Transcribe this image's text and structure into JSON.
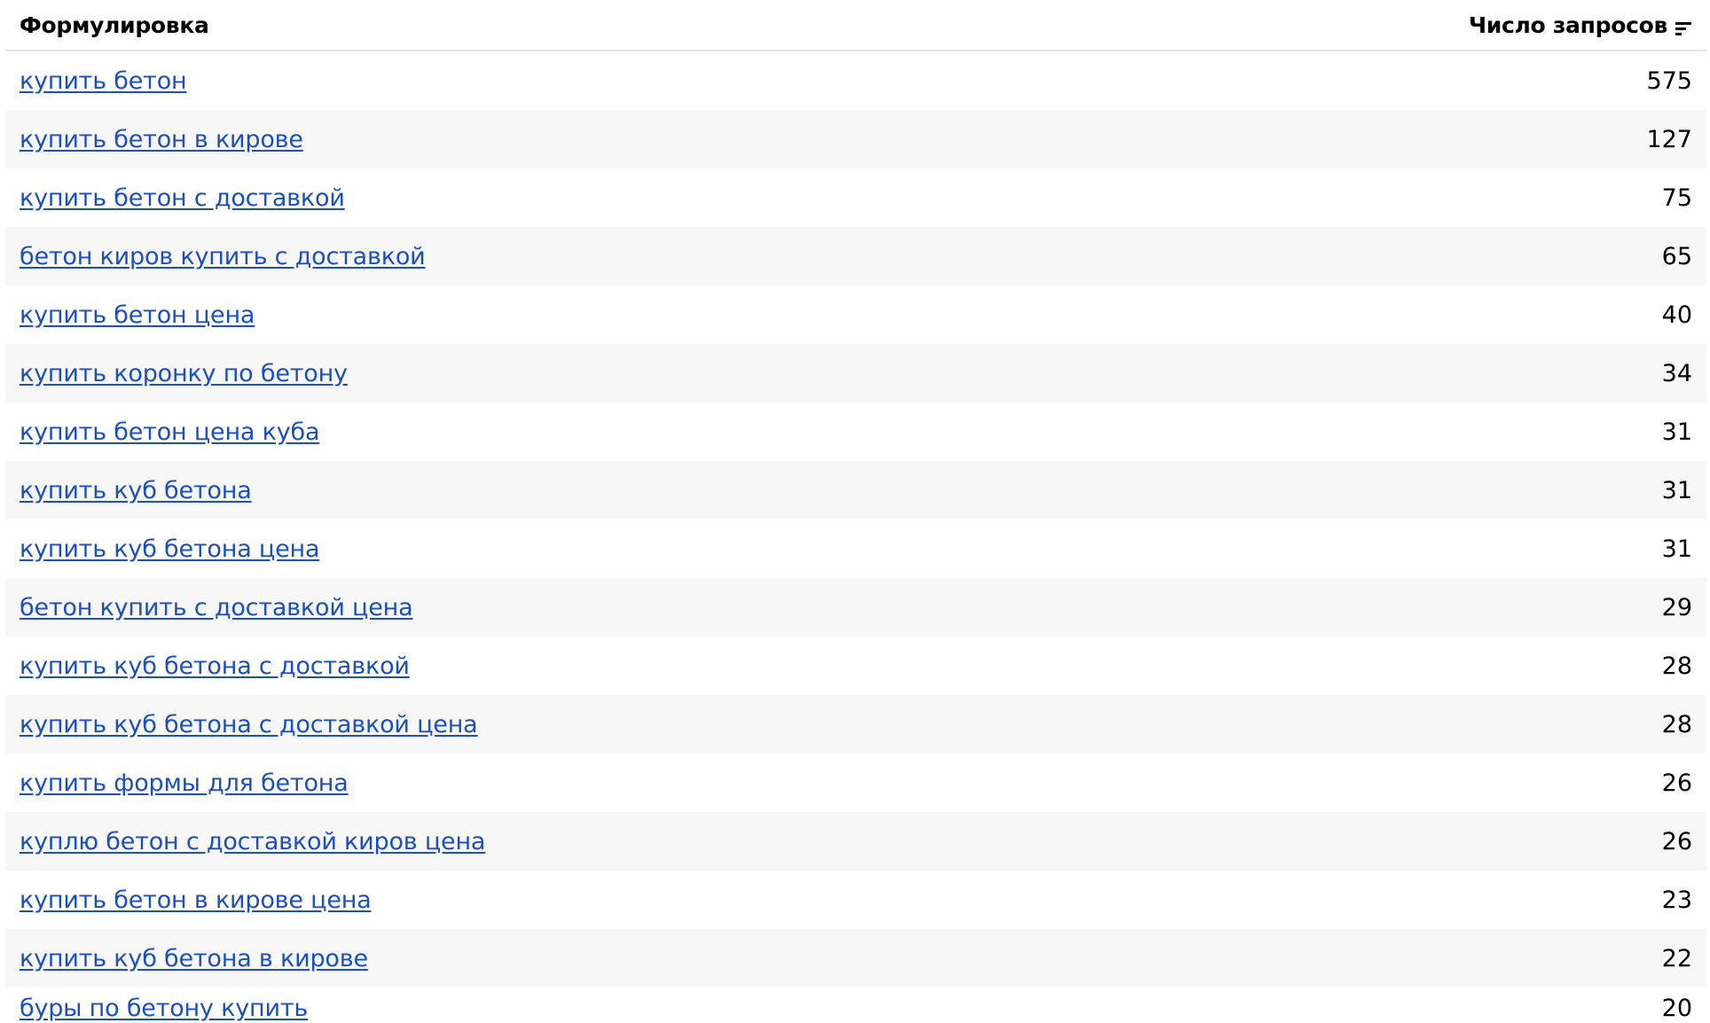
{
  "table": {
    "header": {
      "phrase_label": "Формулировка",
      "count_label": "Число запросов",
      "sort_icon": "sort-lines-icon"
    },
    "rows": [
      {
        "phrase": "купить бетон",
        "count": "575"
      },
      {
        "phrase": "купить бетон в кирове",
        "count": "127"
      },
      {
        "phrase": "купить бетон с доставкой",
        "count": "75"
      },
      {
        "phrase": "бетон киров купить с доставкой",
        "count": "65"
      },
      {
        "phrase": "купить бетон цена",
        "count": "40"
      },
      {
        "phrase": "купить коронку по бетону",
        "count": "34"
      },
      {
        "phrase": "купить бетон цена куба",
        "count": "31"
      },
      {
        "phrase": "купить куб бетона",
        "count": "31"
      },
      {
        "phrase": "купить куб бетона цена",
        "count": "31"
      },
      {
        "phrase": "бетон купить с доставкой цена",
        "count": "29"
      },
      {
        "phrase": "купить куб бетона с доставкой",
        "count": "28"
      },
      {
        "phrase": "купить куб бетона с доставкой цена",
        "count": "28"
      },
      {
        "phrase": "купить формы для бетона",
        "count": "26"
      },
      {
        "phrase": "куплю бетон с доставкой киров цена",
        "count": "26"
      },
      {
        "phrase": "купить бетон в кирове цена",
        "count": "23"
      },
      {
        "phrase": "купить куб бетона в кирове",
        "count": "22"
      },
      {
        "phrase": "буры по бетону купить",
        "count": "20"
      }
    ]
  }
}
